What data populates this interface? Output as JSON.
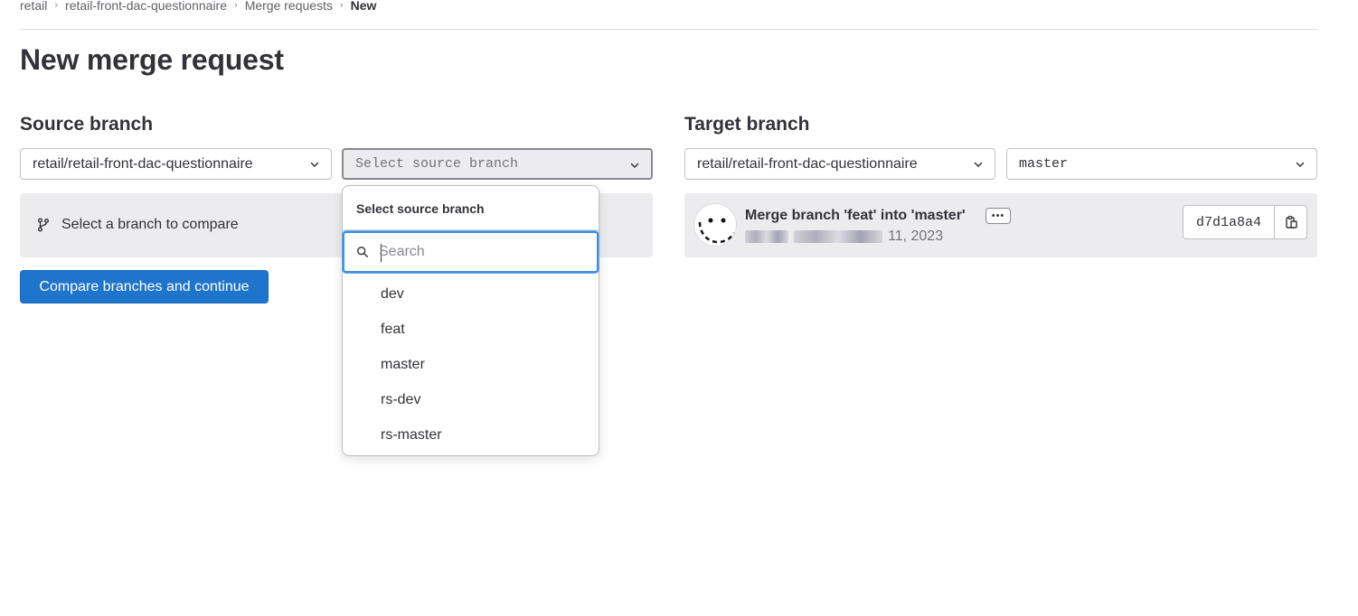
{
  "breadcrumb": {
    "items": [
      "retail",
      "retail-front-dac-questionnaire",
      "Merge requests",
      "New"
    ]
  },
  "page": {
    "title": "New merge request"
  },
  "source": {
    "title": "Source branch",
    "project": "retail/retail-front-dac-questionnaire",
    "branch_placeholder": "Select source branch",
    "compare_message": "Select a branch to compare",
    "compare_button": "Compare branches and continue"
  },
  "dropdown": {
    "header": "Select source branch",
    "search_placeholder": "Search",
    "items": [
      "dev",
      "feat",
      "master",
      "rs-dev",
      "rs-master"
    ]
  },
  "target": {
    "title": "Target branch",
    "project": "retail/retail-front-dac-questionnaire",
    "branch": "master",
    "commit": {
      "title": "Merge branch 'feat' into 'master'",
      "date_suffix": "11, 2023",
      "sha": "d7d1a8a4",
      "more_label": "•••"
    }
  },
  "icons": {
    "branch": "git-branch-icon",
    "chevron": "chevron-down-icon",
    "search": "search-icon",
    "copy": "copy-icon",
    "separator": "chevron-right-icon"
  },
  "colors": {
    "primary": "#1f75cb",
    "focus": "#428fdc",
    "panel": "#ececef"
  }
}
